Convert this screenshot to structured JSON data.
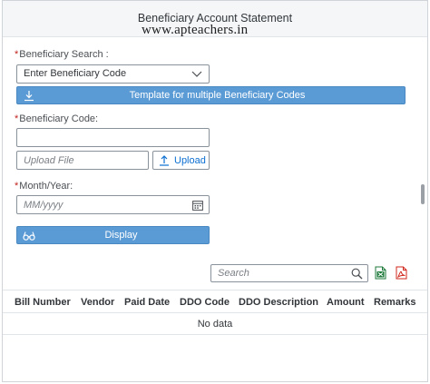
{
  "header": {
    "title": "Beneficiary Account Statement",
    "watermark": "www.apteachers.in"
  },
  "form": {
    "beneficiary_search": {
      "label": "Beneficiary Search :",
      "required_mark": "*",
      "selected_value": "Enter Beneficiary Code"
    },
    "template_button_label": "Template for multiple Beneficiary Codes",
    "beneficiary_code": {
      "label": "Beneficiary Code:",
      "required_mark": "*",
      "value": ""
    },
    "upload_file": {
      "placeholder": "Upload File",
      "button_label": "Upload"
    },
    "month_year": {
      "label": "Month/Year:",
      "required_mark": "*",
      "placeholder": "MM/yyyy"
    },
    "display_button_label": "Display"
  },
  "table": {
    "search_placeholder": "Search",
    "columns": [
      "Bill Number",
      "Vendor",
      "Paid Date",
      "DDO Code",
      "DDO Description",
      "Amount",
      "Remarks"
    ],
    "empty_text": "No data"
  },
  "icons": {
    "dropdown": "chevron-down-icon",
    "template": "download-icon",
    "upload": "upload-icon",
    "calendar": "calendar-icon",
    "display": "glasses-icon",
    "search": "search-icon",
    "excel": "excel-export-icon",
    "pdf": "pdf-export-icon"
  },
  "colors": {
    "primary_button": "#5b9bd5",
    "required": "#c0241f",
    "link": "#0a6ed1",
    "excel": "#1d7a3a",
    "pdf": "#d0271d"
  }
}
